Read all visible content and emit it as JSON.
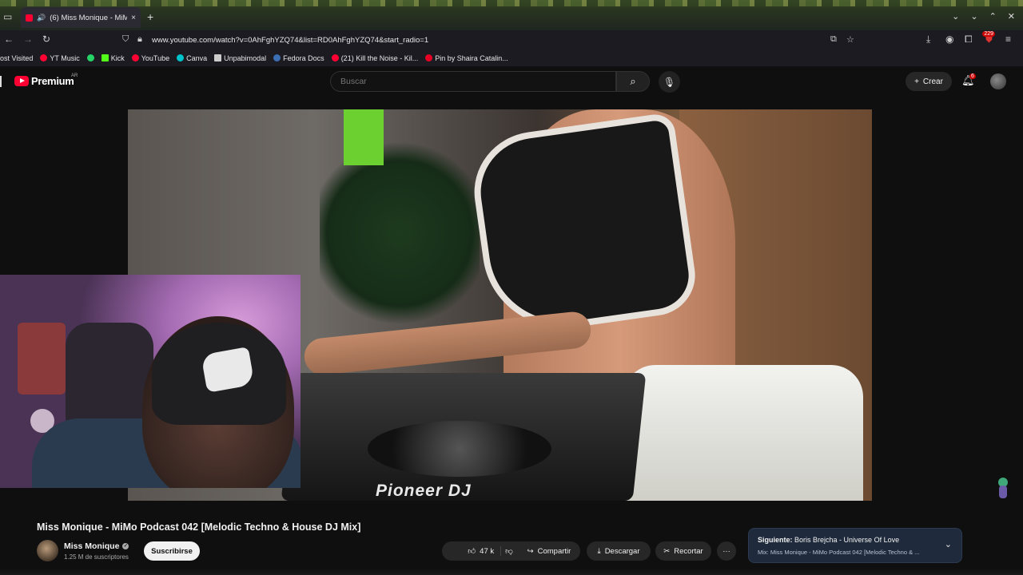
{
  "browser": {
    "tab": {
      "title": "(6) Miss Monique - MiMo",
      "close": "×"
    },
    "new_tab": "+",
    "url": "www.youtube.com/watch?v=0AhFghYZQ74&list=RD0AhFghYZQ74&start_radio=1",
    "extension_badge": "229",
    "bookmarks": [
      {
        "label": "ost Visited",
        "color": "transparent"
      },
      {
        "label": "YT Music",
        "color": "#ff0033"
      },
      {
        "label": "",
        "color": "#25d366"
      },
      {
        "label": "Kick",
        "color": "#53fc18"
      },
      {
        "label": "YouTube",
        "color": "#ff0033"
      },
      {
        "label": "Canva",
        "color": "#00c4cc"
      },
      {
        "label": "Unpabimodal",
        "color": "#cccccc"
      },
      {
        "label": "Fedora Docs",
        "color": "#3c6eb4"
      },
      {
        "label": "(21) Kill the Noise - Kil...",
        "color": "#ff0033"
      },
      {
        "label": "Pin by Shaira Catalin...",
        "color": "#e60023"
      }
    ]
  },
  "youtube": {
    "logo_text": "Premium",
    "country": "AR",
    "search": {
      "placeholder": "Buscar"
    },
    "create_label": "Crear",
    "notifications_count": "6"
  },
  "video": {
    "title": "Miss Monique - MiMo Podcast 042 [Melodic Techno & House DJ Mix]",
    "brand_text": "Pioneer DJ",
    "channel": {
      "name": "Miss Monique",
      "subscribers": "1.25 M de suscriptores"
    },
    "subscribe_label": "Suscribirse",
    "likes": "47 k",
    "actions": {
      "share": "Compartir",
      "download": "Descargar",
      "clip": "Recortar",
      "more": "···"
    },
    "up_next": {
      "label": "Siguiente:",
      "title": "Boris Brejcha - Universe Of Love",
      "playlist": "Mix: Miss Monique - MiMo Podcast 042 [Melodic Techno & ..."
    }
  }
}
